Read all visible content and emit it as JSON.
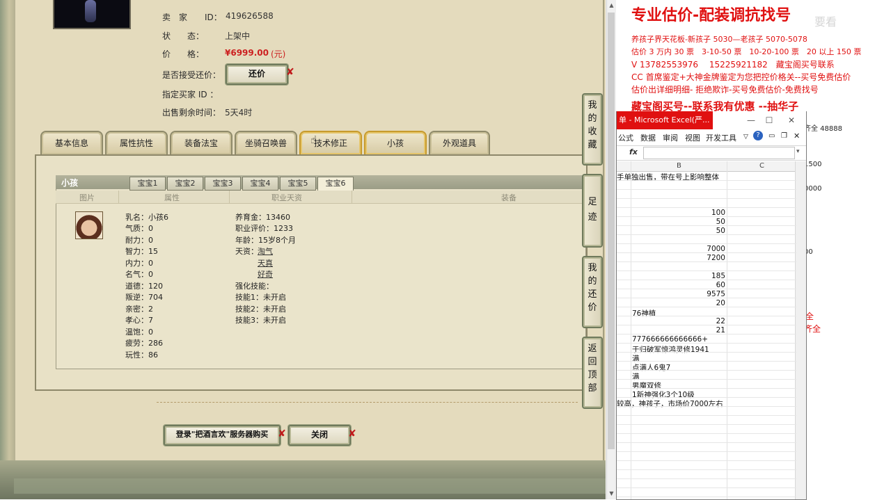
{
  "listing": {
    "seller_label": "卖　家",
    "id_label": "ID：",
    "seller_id": "419626588",
    "status_label": "状　　态：",
    "status_value": "上架中",
    "price_label": "价　　格：",
    "price_value": "¥6999.00",
    "price_unit": "(元)",
    "counter_label": "是否接受还价：",
    "counter_button": "还价",
    "buyer_label": "指定买家 ID ：",
    "remain_label": "出售剩余时间：",
    "remain_value": "5天4时"
  },
  "tabs": [
    "基本信息",
    "属性抗性",
    "装备法宝",
    "坐骑召唤兽",
    "技术修正",
    "小孩",
    "外观道具"
  ],
  "child_panel": {
    "title": "小孩",
    "sub_tabs": [
      "宝宝1",
      "宝宝2",
      "宝宝3",
      "宝宝4",
      "宝宝5",
      "宝宝6"
    ],
    "columns": [
      "图片",
      "属性",
      "职业天资",
      "装备"
    ],
    "attrs_left": [
      "乳名：小孩6",
      "气质：0",
      "耐力：0",
      "智力：15",
      "内力：0",
      "名气：0",
      "道德：120",
      "叛逆：704",
      "亲密：2",
      "孝心：7",
      "温饱：0",
      "疲劳：286",
      "玩性：86"
    ],
    "attrs_right": [
      "养育金：13460",
      "职业评价：1233",
      "年龄：15岁8个月",
      "天资："
    ],
    "talents": [
      "淘气",
      "天真",
      "好奇"
    ],
    "skill_title": "强化技能：",
    "skills": [
      "技能1：未开启",
      "技能2：未开启",
      "技能3：未开启"
    ]
  },
  "bottom_buttons": {
    "login": "登录\"把酒言欢\"服务器购买",
    "close": "关闭"
  },
  "side_buttons": [
    "我的收藏",
    "足迹",
    "我的还价",
    "返回顶部"
  ],
  "doc": {
    "headline": "专业估价-配装调抗找号",
    "line1": "养孩子界天花板-新孩子 5030—老孩子 5070-5078",
    "line2": "估价 3 万内 30 票　3-10-50 票　10-20-100 票　20 以上 150 票",
    "line3": "V 13782553976　 15225921182　藏宝阁买号联系",
    "line4": "CC 首席鉴定+大神金牌鉴定为您把控价格关--买号免费估价",
    "line5": "估价出详细明细- 拒绝欺诈-买号免费估价-免费找号",
    "headline2": "藏宝阁买号--联系我有优惠 --抽华子",
    "frag1": "齐全 48888",
    "frag2": "1500",
    "frag3": "0000",
    "frag4": "00",
    "frag5": "全",
    "frag6": "齐全",
    "watermark": "要看"
  },
  "excel": {
    "title": "单 - Microsoft Excel(严...",
    "menu": [
      "公式",
      "数据",
      "审阅",
      "视图",
      "开发工具"
    ],
    "col_b": "B",
    "col_c": "C",
    "row_top": "手单独出售，带在号上影响整体",
    "numbers": [
      "100",
      "50",
      "50",
      "7000",
      "7200",
      "185",
      "60",
      "9575",
      "20",
      "22",
      "21"
    ],
    "text_rows": [
      "76神植",
      "777666666666666+",
      "于归破军惊鸿灵修1941",
      "满",
      "点满人6鬼7",
      "满",
      "男魔双修",
      "1新神强化3个10级",
      "较高，神孩子，市场价7000左右"
    ]
  }
}
